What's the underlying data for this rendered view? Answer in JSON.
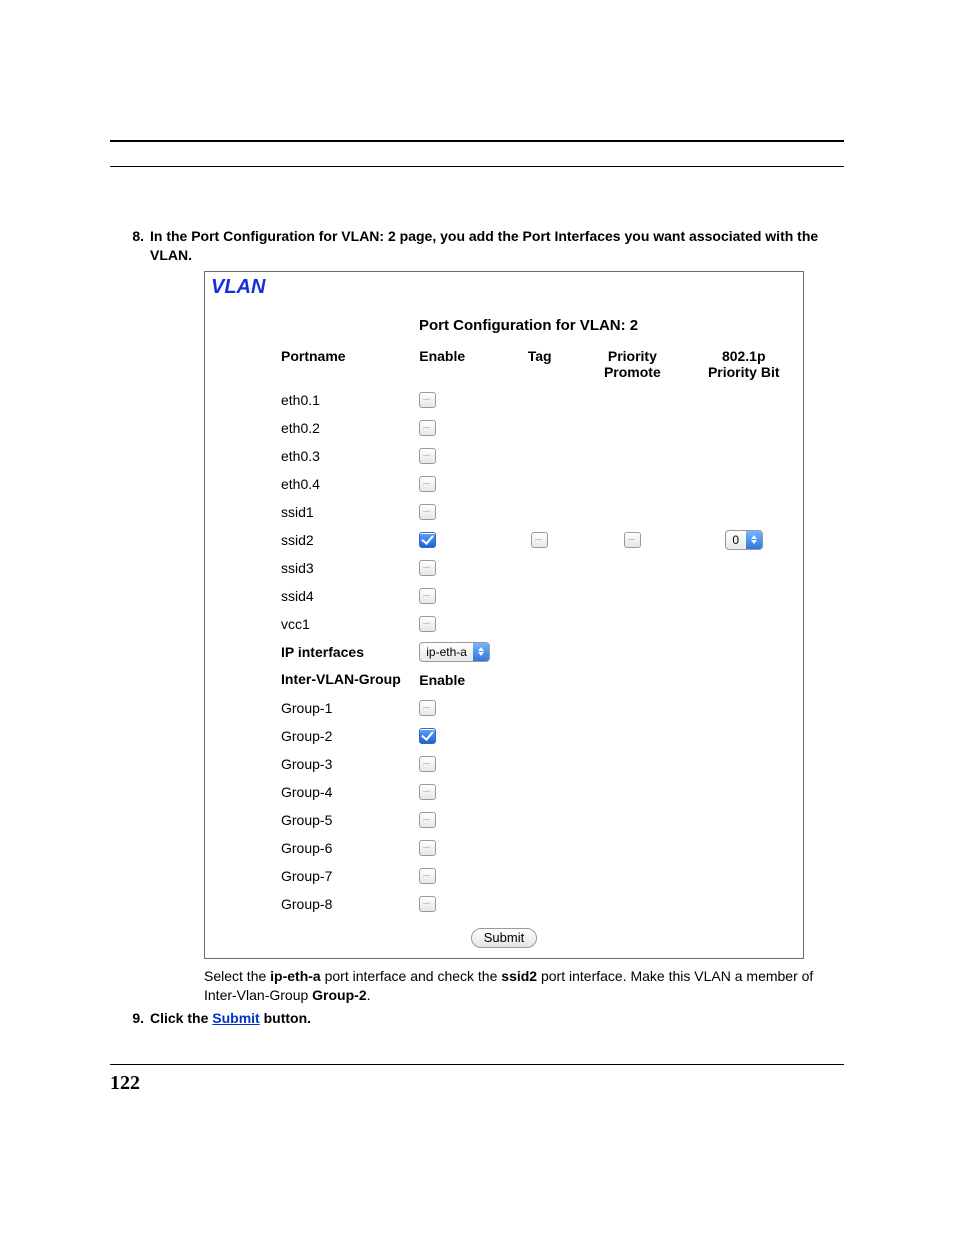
{
  "step8": {
    "num": "8.",
    "text": "In the Port Configuration for VLAN: 2 page, you add the Port Interfaces you want associated with the VLAN."
  },
  "panel": {
    "heading": "VLAN",
    "section_title": "Port Configuration for VLAN: 2",
    "cols": {
      "portname": "Portname",
      "enable": "Enable",
      "tag": "Tag",
      "priority_promote": "Priority Promote",
      "p8021": "802.1p Priority Bit"
    },
    "ports": [
      {
        "name": "eth0.1",
        "enabled": false
      },
      {
        "name": "eth0.2",
        "enabled": false
      },
      {
        "name": "eth0.3",
        "enabled": false
      },
      {
        "name": "eth0.4",
        "enabled": false
      },
      {
        "name": "ssid1",
        "enabled": false
      },
      {
        "name": "ssid2",
        "enabled": true,
        "tag": false,
        "priority_promote": false,
        "priority_bit": "0"
      },
      {
        "name": "ssid3",
        "enabled": false
      },
      {
        "name": "ssid4",
        "enabled": false
      },
      {
        "name": "vcc1",
        "enabled": false
      }
    ],
    "ip_interfaces": {
      "label": "IP interfaces",
      "value": "ip-eth-a"
    },
    "inter_vlan": {
      "label": "Inter-VLAN-Group",
      "enable_label": "Enable",
      "groups": [
        {
          "name": "Group-1",
          "enabled": false
        },
        {
          "name": "Group-2",
          "enabled": true
        },
        {
          "name": "Group-3",
          "enabled": false
        },
        {
          "name": "Group-4",
          "enabled": false
        },
        {
          "name": "Group-5",
          "enabled": false
        },
        {
          "name": "Group-6",
          "enabled": false
        },
        {
          "name": "Group-7",
          "enabled": false
        },
        {
          "name": "Group-8",
          "enabled": false
        }
      ]
    },
    "submit": "Submit"
  },
  "after_panel": {
    "pre": "Select the ",
    "b1": "ip-eth-a",
    "mid1": " port interface and check the ",
    "b2": "ssid2",
    "mid2": " port interface. Make this VLAN a member of Inter-Vlan-Group ",
    "b3": "Group-2",
    "end": "."
  },
  "step9": {
    "num": "9.",
    "pre": "Click the ",
    "link": "Submit",
    "post": " button."
  },
  "page_number": "122"
}
